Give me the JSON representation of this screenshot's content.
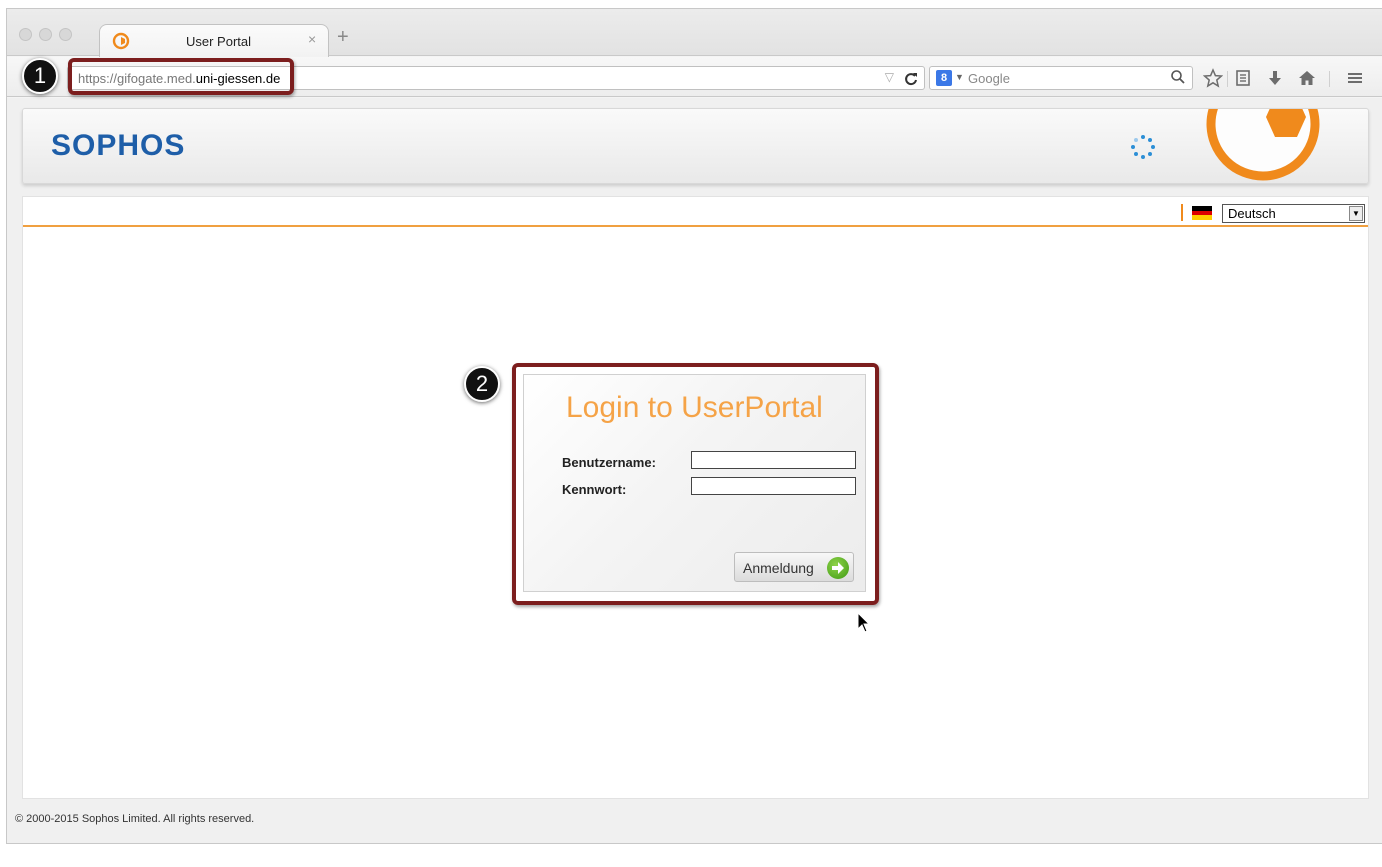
{
  "browser": {
    "tab_title": "User Portal",
    "tab_close": "×",
    "new_tab": "+",
    "url_prefix": "https://gifogate.med.",
    "url_domain": "uni-giessen.de",
    "url_dropmark": "▽",
    "reload": "C",
    "search_engine_badge": "8",
    "search_placeholder": "Google",
    "toolbar_icons": [
      "star-icon",
      "reading-list-icon",
      "download-icon",
      "home-icon",
      "menu-icon"
    ]
  },
  "callouts": [
    "1",
    "2"
  ],
  "header": {
    "logo": "SOPHOS",
    "accent_color": "#f08a1c",
    "logo_color": "#1e5ea8"
  },
  "language": {
    "selected": "Deutsch"
  },
  "login": {
    "title": "Login to UserPortal",
    "username_label": "Benutzername:",
    "password_label": "Kennwort:",
    "username_value": "",
    "password_value": "",
    "submit_label": "Anmeldung"
  },
  "footer": {
    "copyright": "© 2000-2015 Sophos Limited. All rights reserved."
  }
}
